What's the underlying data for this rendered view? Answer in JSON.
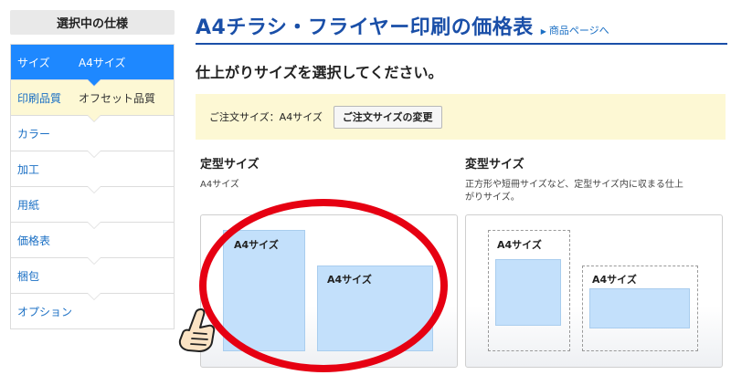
{
  "sidebar": {
    "header": "選択中の仕様",
    "items": [
      {
        "label": "サイズ",
        "value": "A4サイズ",
        "state": "active"
      },
      {
        "label": "印刷品質",
        "value": "オフセット品質",
        "state": "done"
      },
      {
        "label": "カラー",
        "value": "",
        "state": "pending"
      },
      {
        "label": "加工",
        "value": "",
        "state": "pending"
      },
      {
        "label": "用紙",
        "value": "",
        "state": "pending"
      },
      {
        "label": "価格表",
        "value": "",
        "state": "pending"
      },
      {
        "label": "梱包",
        "value": "",
        "state": "pending"
      },
      {
        "label": "オプション",
        "value": "",
        "state": "pending"
      }
    ]
  },
  "header": {
    "title": "A4チラシ・フライヤー印刷の価格表",
    "product_link": "商品ページへ",
    "link_icon": "right-triangle-icon"
  },
  "main": {
    "subtitle": "仕上がりサイズを選択してください。",
    "order": {
      "label": "ご注文サイズ：A4サイズ",
      "change_button": "ご注文サイズの変更"
    },
    "standard": {
      "title": "定型サイズ",
      "desc": "A4サイズ",
      "sheet_label_1": "A4サイズ",
      "sheet_label_2": "A4サイズ"
    },
    "custom": {
      "title": "変型サイズ",
      "desc_line1": "正方形や短冊サイズなど、定型サイズ内に収まる仕上",
      "desc_line2": "がりサイズ。",
      "sheet_label_1": "A4サイズ",
      "sheet_label_2": "A4サイズ"
    }
  },
  "colors": {
    "brand_blue": "#1a4fa8",
    "active_item": "#1e88ff",
    "highlight_yellow": "#fdf8d4",
    "sheet_blue": "#c3e0fb",
    "annotation_red": "#e60012"
  }
}
